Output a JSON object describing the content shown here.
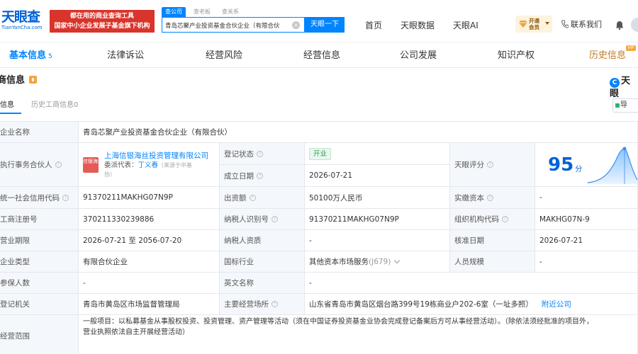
{
  "header": {
    "logo_main": "天眼查",
    "logo_sub": "TianYanCha.com",
    "slogan_line1": "都在用的商业查询工具",
    "slogan_line2": "国家中小企业发展子基金旗下机构",
    "search_tabs": [
      "查公司",
      "查老板",
      "查关系"
    ],
    "search_value": "青岛芯聚产业投资基金合伙企业（有限合伙",
    "search_button": "天眼一下",
    "nav": [
      "首页",
      "天眼数据",
      "天眼AI"
    ],
    "vip_label_1": "开通",
    "vip_label_2": "会员",
    "contact": "联系我们"
  },
  "tabs": {
    "items": [
      "基本信息",
      "法律诉讼",
      "经营风险",
      "经营信息",
      "公司发展",
      "知识产权",
      "历史信息"
    ],
    "basic_count": "5",
    "vip_tag": "VIP"
  },
  "section": {
    "title": "商信息",
    "brand": "天眼",
    "subtabs": [
      "商信息",
      "历史工商信息0"
    ],
    "export_label": "导"
  },
  "info": {
    "company_name_label": "企业名称",
    "company_name": "青岛芯聚产业投资基金合伙企业（有限合伙）",
    "partner_label": "执行事务合伙人",
    "partner_logo": "信银海丝",
    "partner_name": "上海信银海丝投资管理有限公司",
    "rep_label": "委派代表：",
    "rep_name": "丁义春",
    "rep_note": "（来源于中基",
    "rep_note2": "协）",
    "status_label": "登记状态",
    "status_value": "开业",
    "found_label": "成立日期",
    "found_value": "2026-07-21",
    "score_label": "天眼评分",
    "score_value": "95",
    "score_unit": "分",
    "credit_code_label": "统一社会信用代码",
    "credit_code": "91370211MAKHG07N9P",
    "capital_label": "出资额",
    "capital_value": "50100万人民币",
    "paid_capital_label": "实缴资本",
    "paid_capital_value": "-",
    "reg_no_label": "工商注册号",
    "reg_no": "370211330239886",
    "taxpayer_label": "纳税人识别号",
    "taxpayer_no": "91370211MAKHG07N9P",
    "org_code_label": "组织机构代码",
    "org_code": "MAKHG07N-9",
    "term_label": "营业期限",
    "term_value": "2026-07-21 至 2056-07-20",
    "taxpayer_qual_label": "纳税人资质",
    "taxpayer_qual_value": "-",
    "approve_label": "核准日期",
    "approve_value": "2026-07-21",
    "type_label": "企业类型",
    "type_value": "有限合伙企业",
    "industry_label": "国标行业",
    "industry_value": "其他资本市场服务",
    "industry_code": "(J679)",
    "staff_size_label": "人员规模",
    "staff_size_value": "-",
    "insured_label": "参保人数",
    "insured_value": "-",
    "english_label": "英文名称",
    "english_value": "-",
    "authority_label": "登记机关",
    "authority_value": "青岛市黄岛区市场监督管理局",
    "address_label": "主要经营场所",
    "address_value": "山东省青岛市黄岛区烟台路399号19栋商业户202-6室（一址多照）",
    "nearby_label": "附近公司",
    "scope_label": "经营范围",
    "scope_line1": "一般项目：以私募基金从事股权投资、投资管理、资产管理等活动（须在中国证券投资基金业协会完成登记备案后方可从事经营活动）。（除依法须经批准的项目外，",
    "scope_line2": "营业执照依法自主开展经营活动）"
  }
}
